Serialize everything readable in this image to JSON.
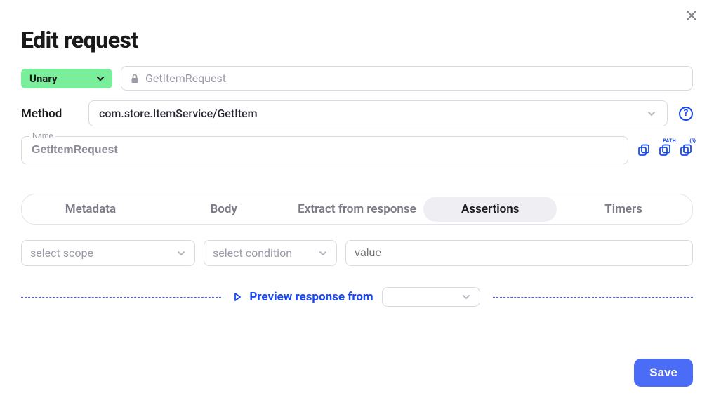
{
  "title": "Edit request",
  "type_select": {
    "value": "Unary"
  },
  "label_field": {
    "value": "GetItemRequest"
  },
  "method": {
    "label": "Method",
    "value": "com.store.ItemService/GetItem"
  },
  "name_field": {
    "float_label": "Name",
    "value": "GetItemRequest"
  },
  "icon_badges": {
    "path": "PATH",
    "n": "{5}"
  },
  "tabs": [
    {
      "label": "Metadata"
    },
    {
      "label": "Body"
    },
    {
      "label": "Extract from response"
    },
    {
      "label": "Assertions",
      "active": true
    },
    {
      "label": "Timers"
    }
  ],
  "assertion": {
    "scope_placeholder": "select scope",
    "condition_placeholder": "select condition",
    "value_placeholder": "value"
  },
  "preview": {
    "label": "Preview response from"
  },
  "footer": {
    "save": "Save"
  }
}
